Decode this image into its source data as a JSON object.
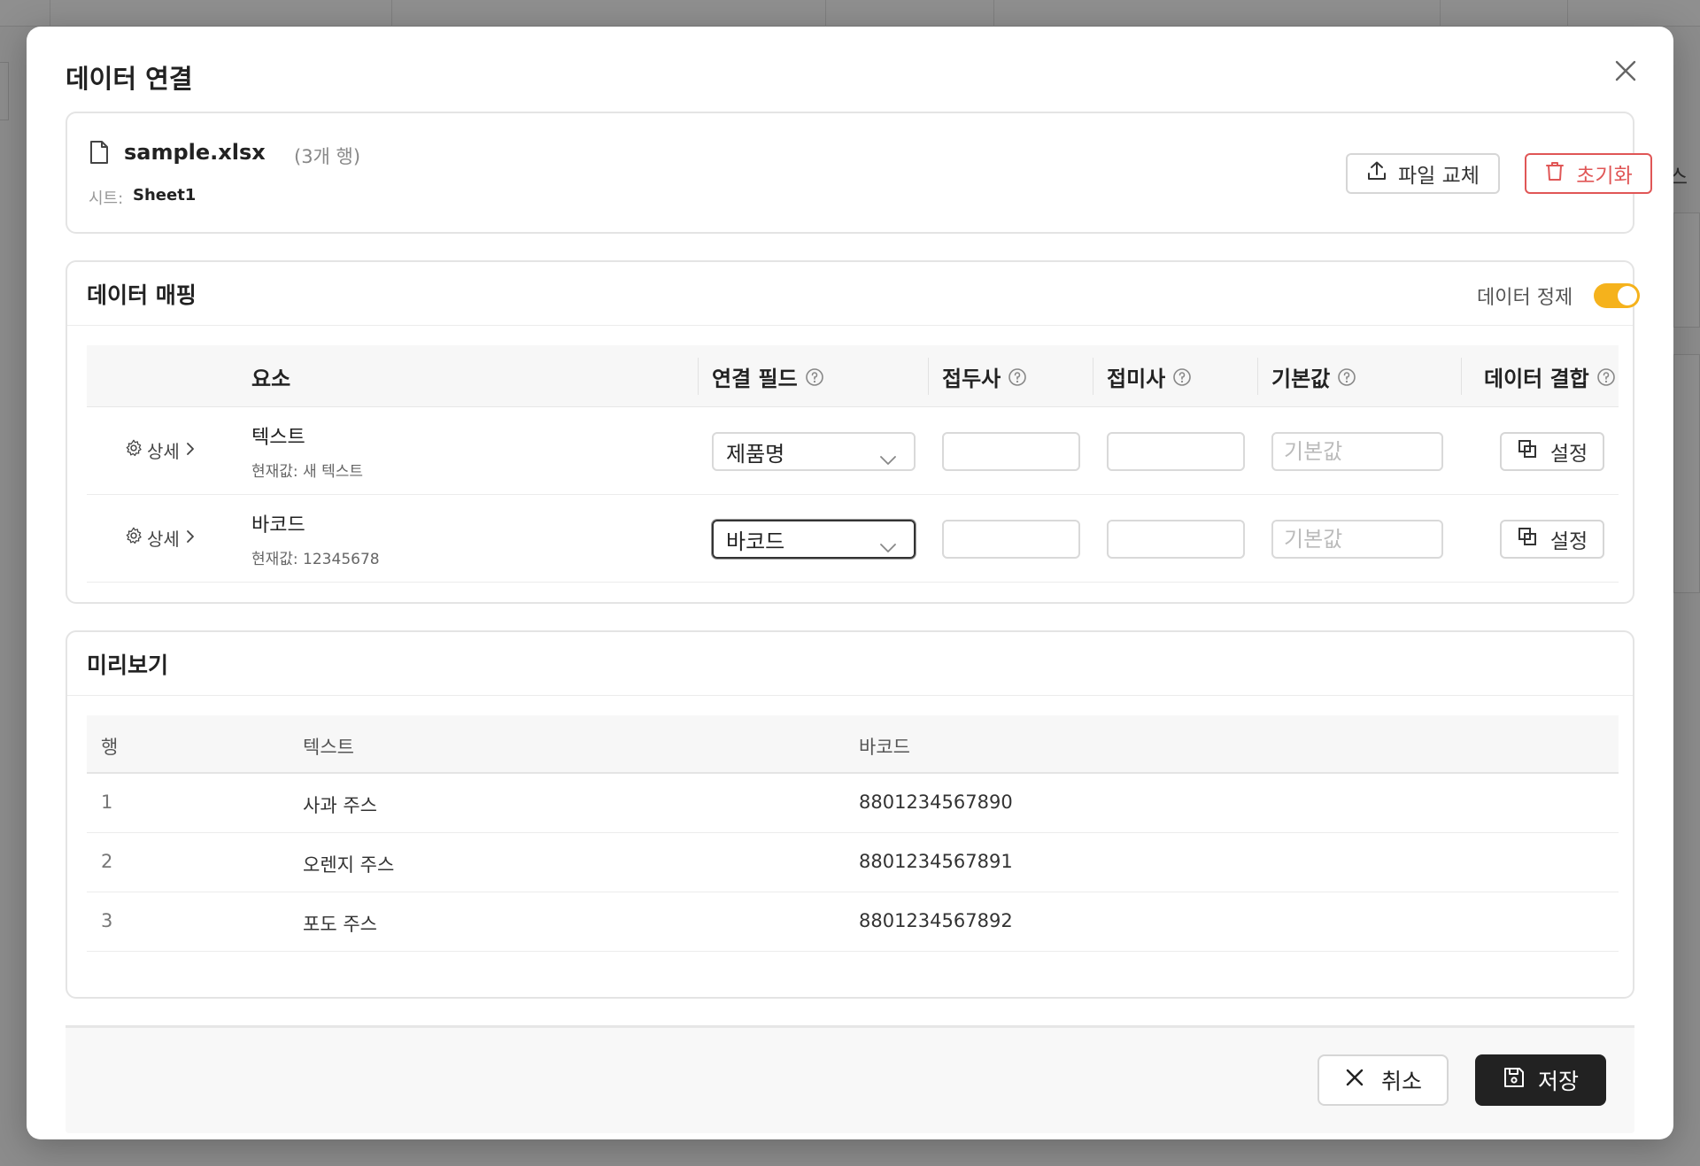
{
  "background": {
    "side_text": "스"
  },
  "modal": {
    "title": "데이터 연결",
    "close_icon": "close-icon"
  },
  "file": {
    "name": "sample.xlsx",
    "rows": "(3개 행)",
    "sheet_label": "시트:",
    "sheet_value": "Sheet1",
    "replace_label": "파일 교체",
    "reset_label": "초기화"
  },
  "mapping": {
    "title": "데이터 매핑",
    "toggle_label": "데이터 정제",
    "toggle_on": true,
    "columns": {
      "element": "요소",
      "field": "연결 필드",
      "prefix": "접두사",
      "suffix": "접미사",
      "default": "기본값",
      "combine": "데이터 결합"
    },
    "rows": [
      {
        "detail": "상세",
        "name": "텍스트",
        "current": "현재값: 새 텍스트",
        "field": "제품명",
        "prefix": "",
        "suffix": "",
        "default_placeholder": "기본값",
        "set_label": "설정"
      },
      {
        "detail": "상세",
        "name": "바코드",
        "current": "현재값: 12345678",
        "field": "바코드",
        "prefix": "",
        "suffix": "",
        "default_placeholder": "기본값",
        "set_label": "설정"
      }
    ]
  },
  "preview": {
    "title": "미리보기",
    "columns": [
      "행",
      "텍스트",
      "바코드"
    ],
    "rows": [
      [
        "1",
        "사과 주스",
        "8801234567890"
      ],
      [
        "2",
        "오렌지 주스",
        "8801234567891"
      ],
      [
        "3",
        "포도 주스",
        "8801234567892"
      ]
    ]
  },
  "footer": {
    "cancel_label": "취소",
    "save_label": "저장"
  },
  "colors": {
    "accent_toggle": "#f5b21c",
    "danger": "#e05656",
    "primary_dark": "#222222"
  }
}
